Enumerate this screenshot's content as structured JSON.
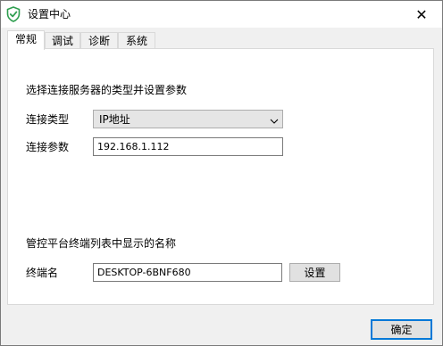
{
  "window": {
    "title": "设置中心",
    "close_symbol": "✕"
  },
  "icons": {
    "app": "shield-check-icon",
    "close": "close-icon",
    "dropdown": "chevron-down-icon"
  },
  "tabs": [
    {
      "label": "常规",
      "active": true
    },
    {
      "label": "调试",
      "active": false
    },
    {
      "label": "诊断",
      "active": false
    },
    {
      "label": "系统",
      "active": false
    }
  ],
  "general": {
    "server_section_heading": "选择连接服务器的类型并设置参数",
    "connection_type_label": "连接类型",
    "connection_type_value": "IP地址",
    "connection_params_label": "连接参数",
    "connection_params_value": "192.168.1.112",
    "terminal_section_heading": "管控平台终端列表中显示的名称",
    "terminal_name_label": "终端名",
    "terminal_name_value": "DESKTOP-6BNF680",
    "set_button_label": "设置"
  },
  "footer": {
    "ok_button_label": "确定"
  },
  "colors": {
    "accent": "#0078d7",
    "shield": "#2e9e4f",
    "window_bg": "#f0f0f0",
    "panel_bg": "#ffffff"
  }
}
